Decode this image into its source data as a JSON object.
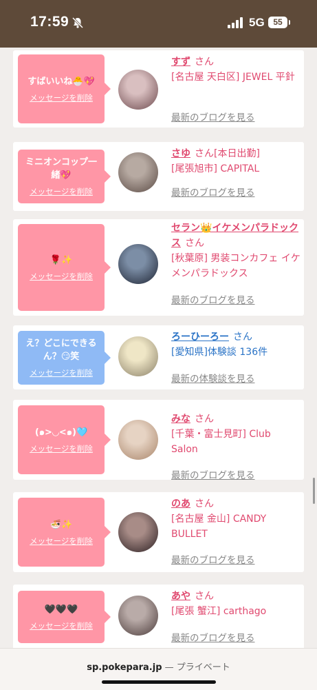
{
  "status_bar": {
    "time": "17:59",
    "network": "5G",
    "battery": "55"
  },
  "entries": [
    {
      "message": "すばいいね🐣💖",
      "delete_label": "メッセージを削除",
      "bubble_color": "pink",
      "name": "すず",
      "suffix": "さん",
      "shop": "[名古屋 天白区] JEWEL 平針",
      "link": "最新のブログを見る",
      "avatar": "avatar-photo",
      "avatar_colors": [
        "#d9bfc0",
        "#6d4a4e"
      ]
    },
    {
      "message": "ミニオンコップ一緒💖",
      "delete_label": "メッセージを削除",
      "bubble_color": "pink",
      "name": "さゆ",
      "suffix": "さん[本日出勤]",
      "shop": "[尾張旭市] CAPITAL",
      "link": "最新のブログを見る",
      "avatar": "avatar-photo",
      "avatar_colors": [
        "#b7aaa2",
        "#5a4a44"
      ]
    },
    {
      "message": "🌹✨",
      "delete_label": "メッセージを削除",
      "bubble_color": "pink",
      "name": "セラン👑イケメンパラドックス",
      "suffix": "さん",
      "shop": "[秋葉原] 男装コンカフェ イケメンパラドックス",
      "link": "最新のブログを見る",
      "avatar": "avatar-photo",
      "avatar_colors": [
        "#7c8ea6",
        "#1e2433"
      ]
    },
    {
      "message": "え？どこにできるん？😏笑",
      "delete_label": "メッセージを削除",
      "bubble_color": "blue",
      "name": "ろーひーろー",
      "suffix": "さん",
      "shop": "[愛知県]体験談 136件",
      "link": "最新の体験談を見る",
      "avatar": "avatar-photo",
      "avatar_colors": [
        "#efe6c6",
        "#8a8068"
      ]
    },
    {
      "message": "(๑>◡<๑)🩵",
      "delete_label": "メッセージを削除",
      "bubble_color": "pink",
      "name": "みな",
      "suffix": "さん",
      "shop": "[千葉・富士見町] Club Salon",
      "link": "最新のブログを見る",
      "avatar": "avatar-photo",
      "avatar_colors": [
        "#e6d3c3",
        "#a9856a"
      ]
    },
    {
      "message": "🍜✨",
      "delete_label": "メッセージを削除",
      "bubble_color": "pink",
      "name": "のあ",
      "suffix": "さん",
      "shop": "[名古屋 金山] CANDY BULLET",
      "link": "最新のブログを見る",
      "avatar": "avatar-photo",
      "avatar_colors": [
        "#a88c87",
        "#2b1f22"
      ]
    },
    {
      "message": "🖤🖤🖤",
      "delete_label": "メッセージを削除",
      "bubble_color": "pink",
      "name": "あや",
      "suffix": "さん",
      "shop": "[尾張 蟹江] carthago",
      "link": "最新のブログを見る",
      "avatar": "avatar-photo",
      "avatar_colors": [
        "#b9aba8",
        "#4b3b3a"
      ]
    }
  ],
  "address_bar": {
    "domain": "sp.pokepara.jp",
    "separator": " — ",
    "mode": "プライベート"
  }
}
